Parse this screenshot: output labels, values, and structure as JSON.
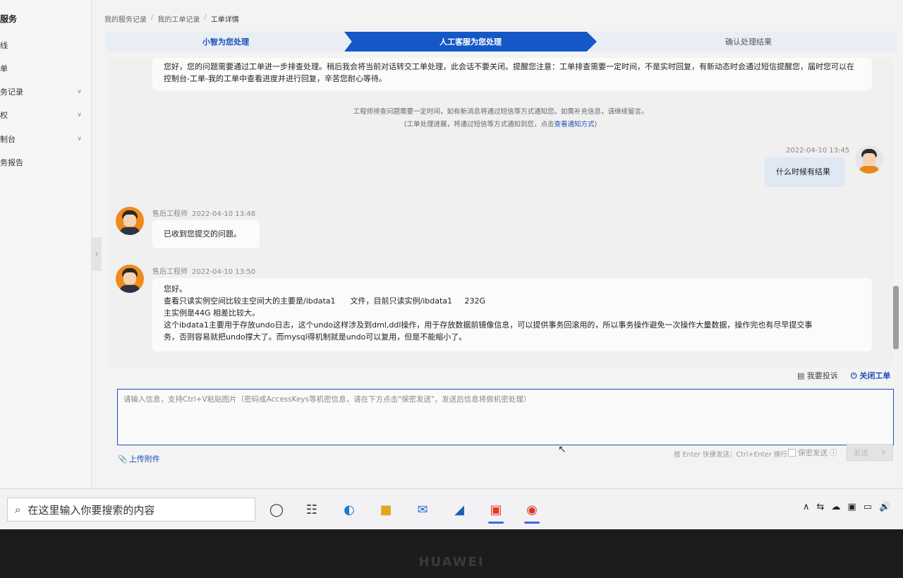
{
  "sidebar": {
    "title": "服务",
    "items": [
      {
        "label": "线",
        "chevron": false
      },
      {
        "label": "单",
        "chevron": false
      },
      {
        "label": "务记录",
        "chevron": true
      },
      {
        "label": "权",
        "chevron": true
      },
      {
        "label": "制台",
        "chevron": true
      },
      {
        "label": "务报告",
        "chevron": false
      }
    ]
  },
  "breadcrumb": [
    "我的服务记录",
    "我的工单记录",
    "工单详情"
  ],
  "steps": [
    "小智为您处理",
    "人工客服为您处理",
    "确认处理结果"
  ],
  "chat": {
    "system_message": "您好，您的问题需要通过工单进一步排查处理。稍后我会将当前对话转交工单处理，此会话不要关闭。提醒您注意：工单排查需要一定时间，不是实时回复，有新动态时会通过短信提醒您，届时您可以在控制台-工单-我的工单中查看进度并进行回复，辛苦您耐心等待。",
    "notice_line1": "工程师排查问题需要一定时间，如有新消息将通过短信等方式通知您。如需补充信息，请继续留言。",
    "notice_line2_prefix": "(工单处理进展，将通过短信等方式通知到您，点击",
    "notice_link": "查看通知方式",
    "notice_line2_suffix": ")",
    "user_message": {
      "time": "2022-04-10 13:45",
      "text": "什么时候有结果"
    },
    "engineer_messages": [
      {
        "role": "售后工程师",
        "time": "2022-04-10 13:48",
        "lines": [
          "已收到您提交的问题。"
        ]
      },
      {
        "role": "售后工程师",
        "time": "2022-04-10 13:50",
        "lines": [
          "您好。",
          "查看只读实例空间比较主空间大的主要是/ibdata1      文件，目前只读实例/ibdata1     232G",
          "主实例是44G 相差比较大。",
          "这个ibdata1主要用于存放undo日志，这个undo这样涉及到dml,ddl操作，用于存放数据前镜像信息，可以提供事务回滚用的，所以事务操作避免一次操作大量数据，操作完也有尽早提交事",
          "务，否则容易就把undo撑大了。而mysql得机制就是undo可以复用，但是不能缩小了。"
        ]
      }
    ]
  },
  "actions": {
    "complain": "我要投诉",
    "close": "关闭工单"
  },
  "input": {
    "value": "",
    "placeholder": "请输入信息，支持Ctrl+V粘贴图片（密码或AccessKeys等机密信息，请在下方点击\"保密发送\"，发送后信息将做机密处理）"
  },
  "footer": {
    "upload": "上传附件",
    "hint": "按 Enter 快捷发送；Ctrl+Enter 换行",
    "secret": "保密发送",
    "send": "发送"
  },
  "taskbar": {
    "search_placeholder": "在这里输入你要搜索的内容",
    "apps": [
      "cortana-icon",
      "task-view-icon",
      "edge-icon",
      "file-explorer-icon",
      "mail-icon",
      "app-icon",
      "app-red-icon",
      "chrome-icon"
    ]
  },
  "bezel_brand": "HUAWEI",
  "colors": {
    "accent": "#1458c7",
    "link": "#1b4fb8",
    "user_bubble": "#dfe8f3"
  }
}
